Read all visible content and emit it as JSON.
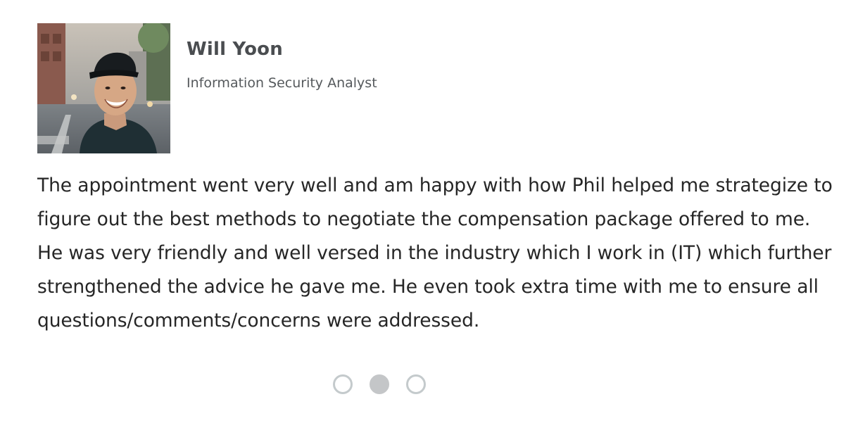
{
  "testimonial": {
    "name": "Will Yoon",
    "role": "Information Security Analyst",
    "quote": "The appointment went very well and am happy with how Phil helped me strategize to figure out the best methods to negotiate the compensation package offered to me. He was very friendly and well versed in the industry which I work in (IT) which further strengthened the advice he gave me. He even took extra time with me to ensure all questions/comments/concerns were addressed."
  },
  "carousel": {
    "slide_count": 3,
    "active_index": 1
  },
  "colors": {
    "name_text": "#4a4d50",
    "role_text": "#55595c",
    "quote_text": "#262626",
    "dot_border": "#c4cacc",
    "dot_active": "#c4c6c8"
  }
}
